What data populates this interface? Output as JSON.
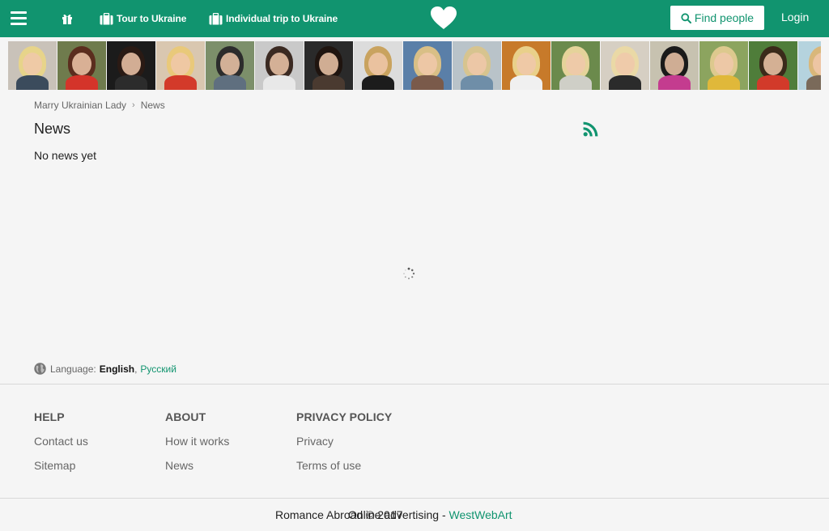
{
  "nav": {
    "menu_icon": "hamburger-icon",
    "gift_icon": "gift-icon",
    "tour_label": "Tour to Ukraine",
    "trip_label": "Individual trip to Ukraine",
    "logo_icon": "heart-icon",
    "find_label": "Find people",
    "login_label": "Login",
    "brand_color": "#11946f"
  },
  "photos": [
    {
      "bg": "#c9c2b9",
      "hair": "#e7d48a",
      "body": "#3b4b5c"
    },
    {
      "bg": "#6f7b4d",
      "hair": "#5b2d1e",
      "body": "#d4342a"
    },
    {
      "bg": "#1b1b1b",
      "hair": "#2a1a14",
      "body": "#2c2c2c"
    },
    {
      "bg": "#d9c7b0",
      "hair": "#e9c97a",
      "body": "#d33a2a"
    },
    {
      "bg": "#7c8f6a",
      "hair": "#2c2c2c",
      "body": "#5f6f7f"
    },
    {
      "bg": "#c9c9c9",
      "hair": "#3b2a22",
      "body": "#e8e8e8"
    },
    {
      "bg": "#2a2a2a",
      "hair": "#1f140f",
      "body": "#4a3a30"
    },
    {
      "bg": "#dcdcdc",
      "hair": "#c9a35f",
      "body": "#1c1c1c"
    },
    {
      "bg": "#5a7fa8",
      "hair": "#d9bf86",
      "body": "#7a5a4a"
    },
    {
      "bg": "#b9c3c9",
      "hair": "#d7c48f",
      "body": "#6f8ea8"
    },
    {
      "bg": "#c77a2a",
      "hair": "#e9d08a",
      "body": "#f0f0f0"
    },
    {
      "bg": "#6b8a4c",
      "hair": "#e5d39a",
      "body": "#cfcfc7"
    },
    {
      "bg": "#d6cfc3",
      "hair": "#ead9a6",
      "body": "#2b2b2b"
    },
    {
      "bg": "#c7c2b0",
      "hair": "#1a1a1a",
      "body": "#c43c8f"
    },
    {
      "bg": "#8ca45f",
      "hair": "#ddc98e",
      "body": "#e0b83a"
    },
    {
      "bg": "#4f7d3a",
      "hair": "#3a2a1a",
      "body": "#d23a2a"
    },
    {
      "bg": "#b5d3de",
      "hair": "#d9b77a",
      "body": "#7a6a5a"
    }
  ],
  "breadcrumb": {
    "home": "Marry Ukrainian Lady",
    "separator": "›",
    "current": "News"
  },
  "main": {
    "title": "News",
    "rss_icon": "rss-icon",
    "empty_message": "No news yet",
    "spinner_icon": "loading-spinner-icon"
  },
  "language": {
    "icon": "globe-icon",
    "label": "Language:",
    "current": "English",
    "separator": ",",
    "alternate": "Русский"
  },
  "footer": {
    "help": {
      "heading": "HELP",
      "links": [
        "Contact us",
        "Sitemap"
      ]
    },
    "about": {
      "heading": "ABOUT",
      "links": [
        "How it works",
        "News"
      ]
    },
    "privacy": {
      "heading": "PRIVACY POLICY",
      "links": [
        "Privacy",
        "Terms of use"
      ]
    },
    "copyright_left": "Romance Abroad © 2017",
    "copyright_overlap": "Online advertising - ",
    "credit_link": "WestWebArt"
  }
}
